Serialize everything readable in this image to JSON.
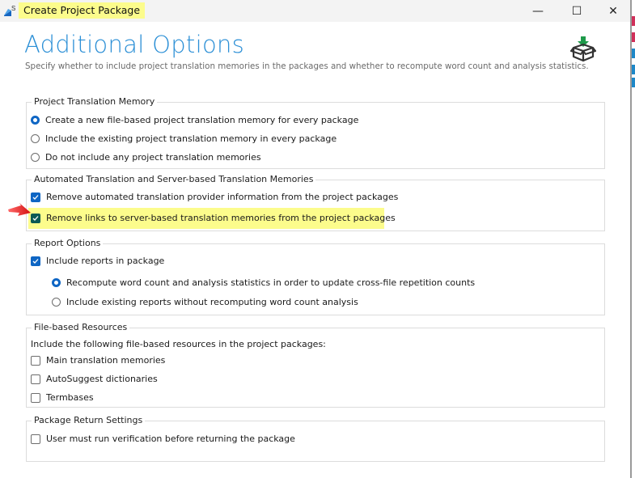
{
  "window": {
    "title": "Create Project Package",
    "app_icon": "trados-studio-icon",
    "controls": {
      "minimize": "—",
      "maximize": "☐",
      "close": "✕"
    }
  },
  "header": {
    "title": "Additional Options",
    "subtitle": "Specify whether to include project translation memories in the packages and whether to recompute word count and analysis statistics.",
    "icon": "package-download-icon"
  },
  "groups": {
    "project_tm": {
      "legend": "Project Translation Memory",
      "options": [
        {
          "label": "Create a new file-based project translation memory for every package",
          "selected": true
        },
        {
          "label": "Include the existing project translation memory in every package",
          "selected": false
        },
        {
          "label": "Do not include any project translation memories",
          "selected": false
        }
      ]
    },
    "automated": {
      "legend": "Automated Translation and Server-based Translation Memories",
      "options": [
        {
          "label": "Remove automated translation provider information from the project packages",
          "checked": true
        },
        {
          "label": "Remove links to server-based translation memories from the project packages",
          "checked": true,
          "highlighted": true
        }
      ]
    },
    "reports": {
      "legend": "Report Options",
      "include": {
        "label": "Include reports in package",
        "checked": true
      },
      "options": [
        {
          "label": "Recompute word count and analysis statistics in order to update cross-file repetition counts",
          "selected": true
        },
        {
          "label": "Include existing reports without recomputing word count analysis",
          "selected": false
        }
      ]
    },
    "resources": {
      "legend": "File-based Resources",
      "intro": "Include the following file-based resources in the project packages:",
      "options": [
        {
          "label": "Main translation memories",
          "checked": false
        },
        {
          "label": "AutoSuggest dictionaries",
          "checked": false
        },
        {
          "label": "Termbases",
          "checked": false
        }
      ]
    },
    "return": {
      "legend": "Package Return Settings",
      "options": [
        {
          "label": "User must run verification before returning the package",
          "checked": false
        }
      ]
    }
  },
  "annotation": {
    "arrow_color": "#e02020",
    "highlight_color": "#fcfc8c"
  },
  "colors": {
    "accent": "#0f66c4",
    "title": "#2b8fd6",
    "checked_dark": "#0c5a54",
    "package_arrow": "#1e9a4a"
  }
}
